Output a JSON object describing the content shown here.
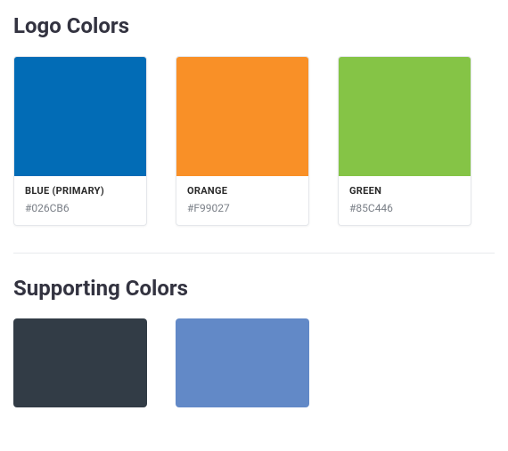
{
  "sections": {
    "logo": {
      "title": "Logo Colors",
      "swatches": [
        {
          "name": "BLUE (PRIMARY)",
          "hex": "#026CB6",
          "color": "#026CB6"
        },
        {
          "name": "ORANGE",
          "hex": "#F99027",
          "color": "#F99027"
        },
        {
          "name": "GREEN",
          "hex": "#85C446",
          "color": "#85C446"
        }
      ]
    },
    "supporting": {
      "title": "Supporting Colors",
      "swatches": [
        {
          "color": "#323C46"
        },
        {
          "color": "#6289C7"
        }
      ]
    }
  }
}
